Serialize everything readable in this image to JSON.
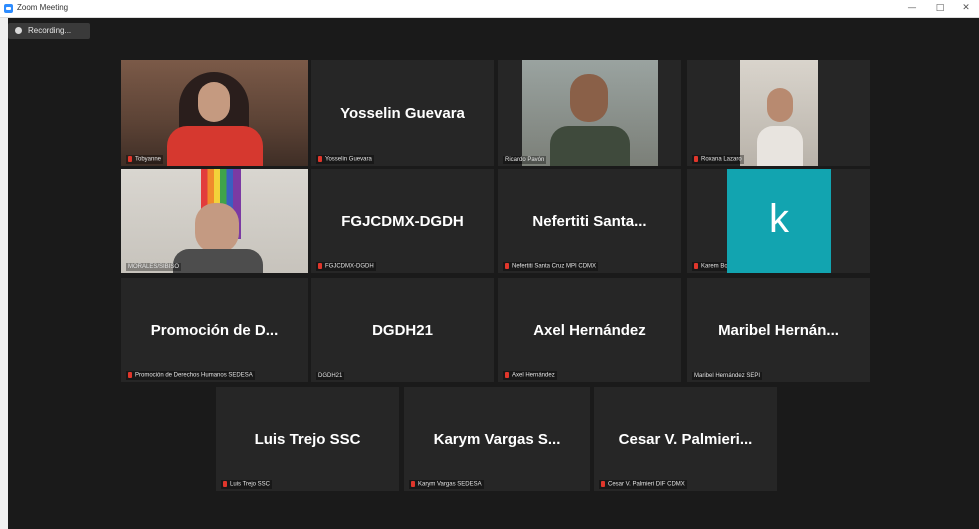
{
  "window": {
    "title": "Zoom Meeting",
    "controls": {
      "minimize": "—",
      "maximize": "□",
      "close": "✕"
    }
  },
  "recording": {
    "label": "Recording..."
  },
  "tiles": [
    {
      "display": "",
      "footer": "Tobyanne"
    },
    {
      "display": "Yosselin Guevara",
      "footer": "Yosselin Guevara"
    },
    {
      "display": "",
      "footer": "Ricardo Pavón"
    },
    {
      "display": "",
      "footer": "Roxana Lazaro"
    },
    {
      "display": "",
      "footer": "MORALES/SIBISO"
    },
    {
      "display": "FGJCDMX-DGDH",
      "footer": "FGJCDMX-DGDH"
    },
    {
      "display": "Nefertiti  Santa...",
      "footer": "Nefertiti Santa Cruz MPI CDMX"
    },
    {
      "display": "k",
      "footer": "Karem Botello"
    },
    {
      "display": "Promoción  de  D...",
      "footer": "Promoción de Derechos Humanos SEDESA"
    },
    {
      "display": "DGDH21",
      "footer": "DGDH21"
    },
    {
      "display": "Axel Hernández",
      "footer": "Axel Hernández"
    },
    {
      "display": "Maribel  Hernán...",
      "footer": "Maribel Hernández SEPI"
    },
    {
      "display": "Luis Trejo SSC",
      "footer": "Luis Trejo SSC"
    },
    {
      "display": "Karym  Vargas  S...",
      "footer": "Karym Vargas SEDESA"
    },
    {
      "display": "Cesar  V.  Palmieri...",
      "footer": "Cesar V. Palmieri DIF CDMX"
    }
  ],
  "colors": {
    "stage": "#1a1a1a",
    "tile": "#262626",
    "active_speaker": "#e5e84a",
    "avatar": "#12a4b0",
    "muted_mic": "#e0362b"
  }
}
